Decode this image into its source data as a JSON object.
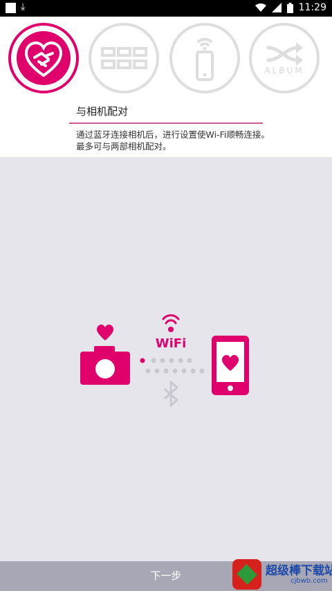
{
  "status_bar": {
    "time": "11:29",
    "icons": [
      "notification-square-icon",
      "download-icon",
      "wifi-icon",
      "signal-icon",
      "battery-icon"
    ]
  },
  "steps": [
    {
      "icon": "handshake-heart-icon",
      "active": true
    },
    {
      "icon": "grid-icon",
      "active": false
    },
    {
      "icon": "phone-wifi-icon",
      "active": false
    },
    {
      "icon": "shuffle-icon",
      "label": "ALBUM",
      "active": false
    }
  ],
  "main": {
    "title": "与相机配对",
    "description": "通过蓝牙连接相机后，进行设置使Wi-Fi顺畅连接。最多可与两部相机配对。"
  },
  "illustration": {
    "wifi_label": "WiFi",
    "icons": [
      "camera-heart-icon",
      "wifi-signal-icon",
      "bluetooth-icon",
      "phone-heart-icon"
    ]
  },
  "footer": {
    "next_label": "下一步"
  },
  "watermark": {
    "title": "超级棒下载站",
    "url": "cjbwb.com"
  },
  "colors": {
    "accent": "#e0006c",
    "background": "#e6e5ec",
    "footer": "#a8a7b6",
    "inactive": "#dedede"
  }
}
